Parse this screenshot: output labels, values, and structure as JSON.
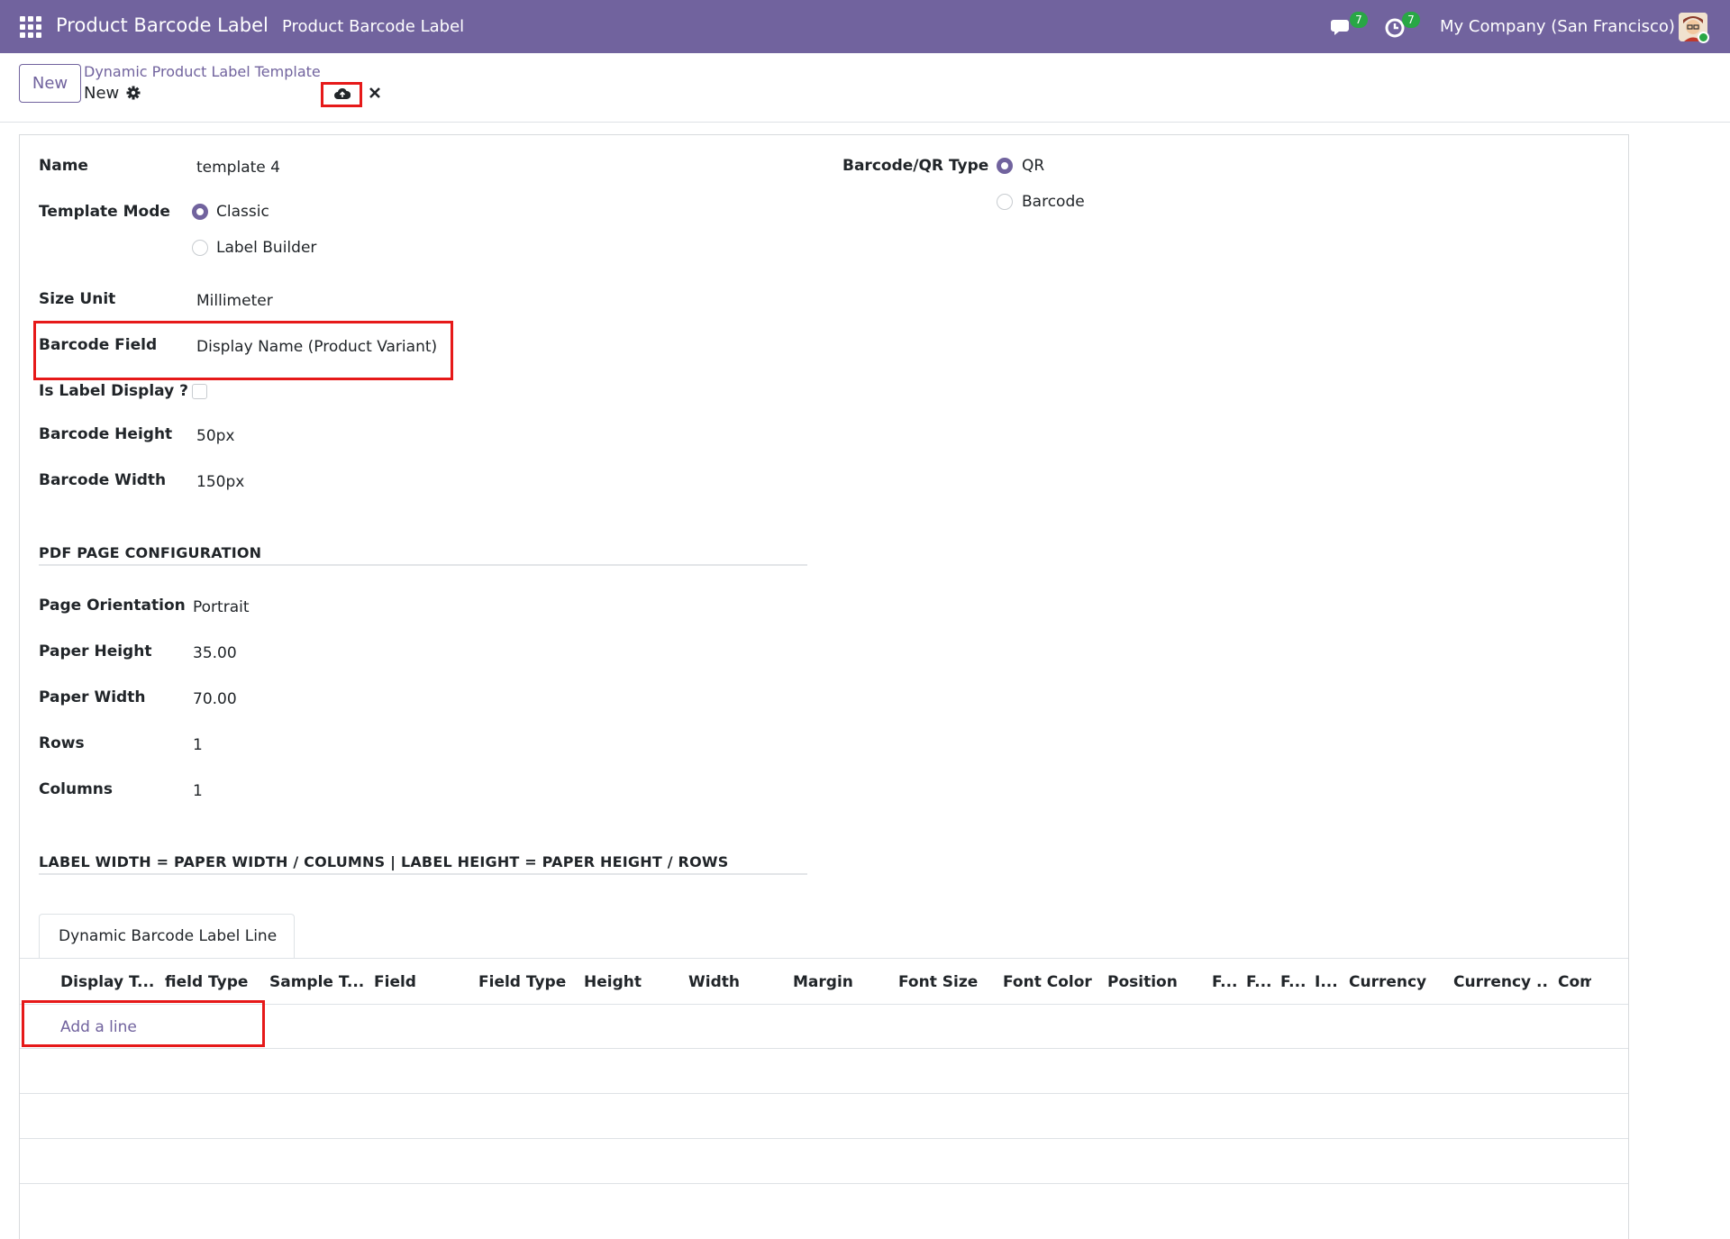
{
  "navbar": {
    "app_title": "Product Barcode Label",
    "menu_item": "Product Barcode Label",
    "messages_count": "7",
    "activities_count": "7",
    "company": "My Company (San Francisco)"
  },
  "control_panel": {
    "new_button": "New",
    "breadcrumb_parent": "Dynamic Product Label Template",
    "breadcrumb_current": "New"
  },
  "form": {
    "name_label": "Name",
    "name_value": "template 4",
    "template_mode_label": "Template Mode",
    "template_mode_options": [
      "Classic",
      "Label Builder"
    ],
    "template_mode_selected": "Classic",
    "size_unit_label": "Size Unit",
    "size_unit_value": "Millimeter",
    "barcode_field_label": "Barcode Field",
    "barcode_field_value": "Display Name (Product Variant)",
    "is_label_display_label": "Is Label Display ?",
    "is_label_display_checked": false,
    "barcode_height_label": "Barcode Height",
    "barcode_height_value": "50px",
    "barcode_width_label": "Barcode Width",
    "barcode_width_value": "150px",
    "barcode_type_label": "Barcode/QR Type",
    "barcode_type_options": [
      "QR",
      "Barcode"
    ],
    "barcode_type_selected": "QR",
    "pdf_section_title": "PDF PAGE CONFIGURATION",
    "page_orientation_label": "Page Orientation",
    "page_orientation_value": "Portrait",
    "paper_height_label": "Paper Height",
    "paper_height_value": "35.00",
    "paper_width_label": "Paper Width",
    "paper_width_value": "70.00",
    "rows_label": "Rows",
    "rows_value": "1",
    "columns_label": "Columns",
    "columns_value": "1",
    "label_formula_title": "LABEL WIDTH = PAPER WIDTH / COLUMNS | LABEL HEIGHT = PAPER HEIGHT / ROWS"
  },
  "notebook": {
    "tab_label": "Dynamic Barcode Label Line",
    "columns": [
      "Display T...",
      "field Type",
      "Sample T...",
      "Field",
      "Field Type",
      "Height",
      "Width",
      "Margin",
      "Font Size",
      "Font Color",
      "Position",
      "F...",
      "F...",
      "F...",
      "I...",
      "Currency",
      "Currency ...",
      "Com"
    ],
    "add_line": "Add a line"
  },
  "colors": {
    "brand": "#71639e",
    "highlight": "#e61919",
    "badge": "#28a745"
  }
}
